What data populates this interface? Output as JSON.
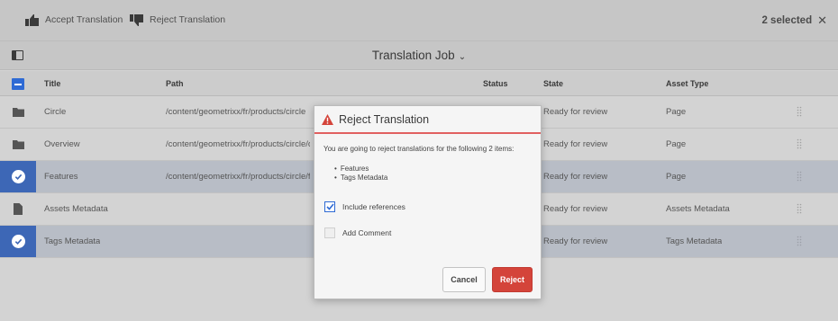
{
  "toolbar": {
    "accept_label": "Accept Translation",
    "reject_label": "Reject Translation",
    "selected_text": "2 selected",
    "close_glyph": "✕"
  },
  "titlebar": {
    "title": "Translation Job",
    "chevron": "⌄"
  },
  "table": {
    "columns": [
      "Title",
      "Path",
      "Status",
      "State",
      "Asset Type"
    ],
    "rows": [
      {
        "title": "Circle",
        "path": "/content/geometrixx/fr/products/circle",
        "status": "",
        "state": "Ready for review",
        "asset_type": "Page",
        "selected": false,
        "icon": "folder-icon"
      },
      {
        "title": "Overview",
        "path": "/content/geometrixx/fr/products/circle/ove",
        "status": "",
        "state": "Ready for review",
        "asset_type": "Page",
        "selected": false,
        "icon": "folder-icon"
      },
      {
        "title": "Features",
        "path": "/content/geometrixx/fr/products/circle/fea",
        "status": "",
        "state": "Ready for review",
        "asset_type": "Page",
        "selected": true,
        "icon": "check-icon"
      },
      {
        "title": "Assets Metadata",
        "path": "",
        "status": "",
        "state": "Ready for review",
        "asset_type": "Assets Metadata",
        "selected": false,
        "icon": "file-icon"
      },
      {
        "title": "Tags Metadata",
        "path": "",
        "status": "",
        "state": "Ready for review",
        "asset_type": "Tags Metadata",
        "selected": true,
        "icon": "check-icon"
      }
    ]
  },
  "dialog": {
    "title": "Reject Translation",
    "message": "You are going to reject translations for the following 2 items:",
    "items": [
      "Features",
      "Tags Metadata"
    ],
    "include_references_label": "Include references",
    "include_references_checked": true,
    "add_comment_label": "Add Comment",
    "add_comment_checked": false,
    "cancel_label": "Cancel",
    "reject_label": "Reject"
  },
  "colors": {
    "accent_blue": "#3d67b6",
    "danger_red": "#d4443a",
    "header_bar": "#c6c6c6"
  }
}
